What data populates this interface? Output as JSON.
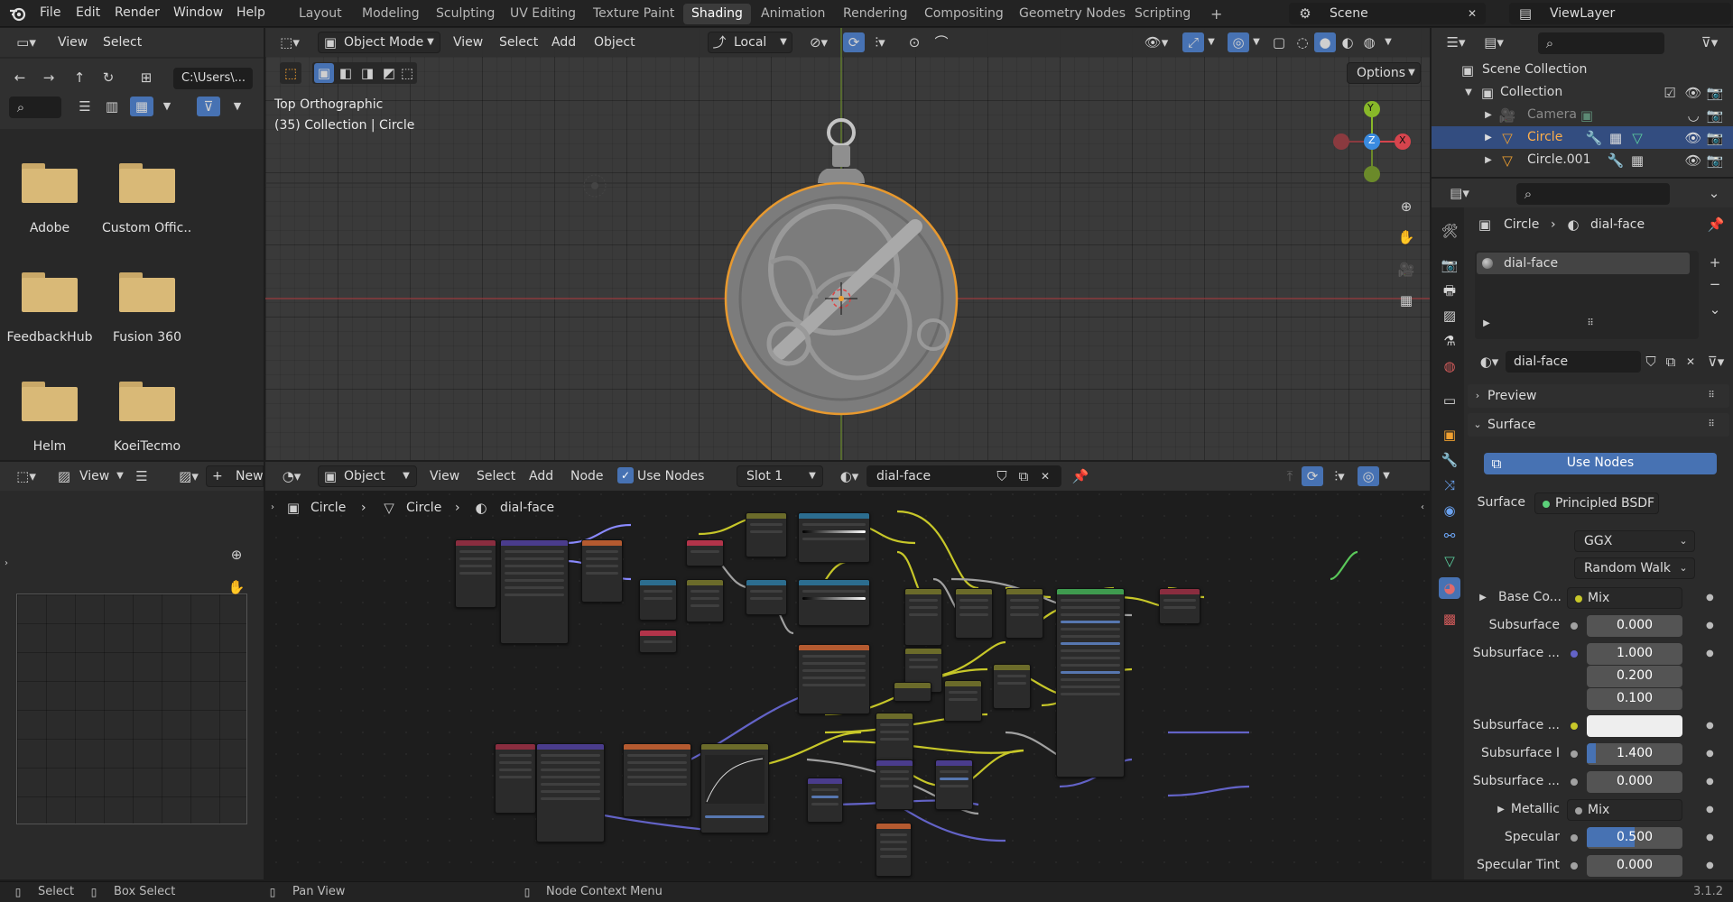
{
  "menu": [
    "File",
    "Edit",
    "Render",
    "Window",
    "Help"
  ],
  "workspaces": [
    "Layout",
    "Modeling",
    "Sculpting",
    "UV Editing",
    "Texture Paint",
    "Shading",
    "Animation",
    "Rendering",
    "Compositing",
    "Geometry Nodes",
    "Scripting"
  ],
  "active_workspace": "Shading",
  "scene_name": "Scene",
  "view_layer": "ViewLayer",
  "file_browser": {
    "menu_view": "View",
    "menu_select": "Select",
    "path": "C:\\Users\\...",
    "folders": [
      "Adobe",
      "Custom Offic...",
      "FeedbackHub",
      "Fusion 360",
      "Helm",
      "KoeiTecmo"
    ]
  },
  "viewport": {
    "mode": "Object Mode",
    "menus": [
      "View",
      "Select",
      "Add",
      "Object"
    ],
    "transform_orientation": "Local",
    "options_label": "Options",
    "overlay_title": "Top Orthographic",
    "overlay_sub": "(35) Collection | Circle",
    "gizmo": {
      "x": "X",
      "y": "Y",
      "z": "Z"
    }
  },
  "outliner": {
    "scene_collection": "Scene Collection",
    "items": [
      {
        "name": "Collection"
      },
      {
        "name": "Camera"
      },
      {
        "name": "Circle"
      },
      {
        "name": "Circle.001"
      }
    ]
  },
  "image_editor": {
    "view": "View",
    "new_label": "New"
  },
  "node_editor": {
    "type": "Object",
    "menus": [
      "View",
      "Select",
      "Add",
      "Node"
    ],
    "use_nodes_label": "Use Nodes",
    "slot": "Slot 1",
    "material": "dial-face",
    "breadcrumb": [
      "Circle",
      "Circle",
      "dial-face"
    ]
  },
  "properties": {
    "breadcrumb": [
      "Circle",
      "dial-face"
    ],
    "material_slot": "dial-face",
    "material_name": "dial-face",
    "preview_label": "Preview",
    "surface_section": "Surface",
    "use_nodes_button": "Use Nodes",
    "surface_label": "Surface",
    "surface_value": "Principled BSDF",
    "distribution": "GGX",
    "subsurface_method": "Random Walk",
    "rows": [
      {
        "label": "Base Co...",
        "value": "Mix"
      },
      {
        "label": "Subsurface",
        "value": "0.000"
      },
      {
        "label": "Subsurface ...",
        "value": "1.000"
      },
      {
        "label": "",
        "value": "0.200"
      },
      {
        "label": "",
        "value": "0.100"
      },
      {
        "label": "Subsurface ...",
        "value": ""
      },
      {
        "label": "Subsurface I",
        "value": "1.400"
      },
      {
        "label": "Subsurface ...",
        "value": "0.000"
      },
      {
        "label": "Metallic",
        "value": "Mix"
      },
      {
        "label": "Specular",
        "value": "0.500"
      },
      {
        "label": "Specular Tint",
        "value": "0.000"
      }
    ]
  },
  "status_bar": {
    "items": [
      "Select",
      "Box Select",
      "Pan View",
      "Node Context Menu"
    ],
    "version": "3.1.2"
  },
  "colors": {
    "selection_orange": "#e8992e",
    "active_blue": "#4772b3",
    "axis_x": "#d6444d",
    "axis_y": "#88b829",
    "axis_z": "#3a8be0"
  }
}
